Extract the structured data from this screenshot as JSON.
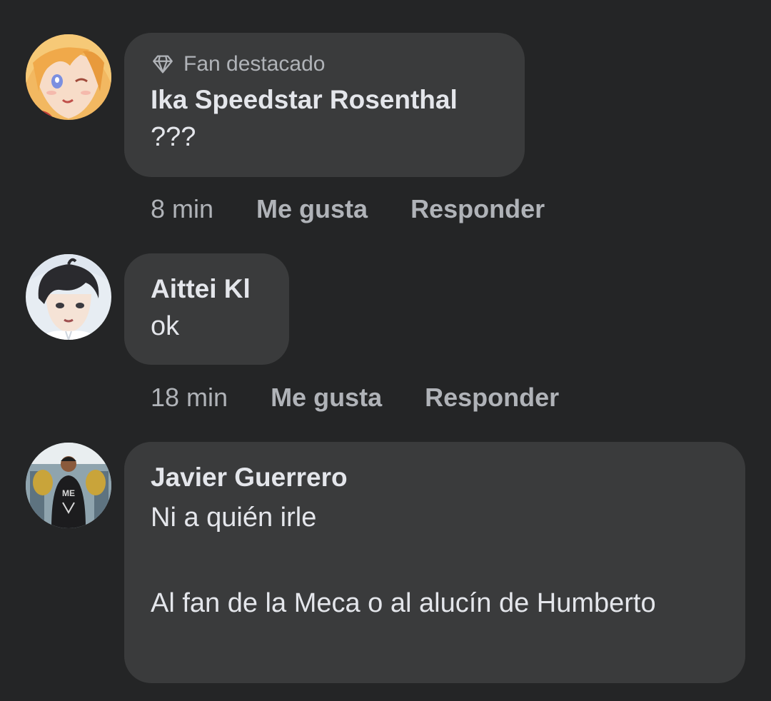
{
  "comments": [
    {
      "badge": "Fan destacado",
      "badge_icon": "diamond-icon",
      "author": "Ika Speedstar Rosenthal",
      "text": "???",
      "time": "8 min",
      "like_label": "Me gusta",
      "reply_label": "Responder"
    },
    {
      "author": "Aittei Kl",
      "text": "ok",
      "time": "18 min",
      "like_label": "Me gusta",
      "reply_label": "Responder"
    },
    {
      "author": "Javier Guerrero",
      "text": "Ni a quién irle\n\nAl fan de la Meca o al alucín de Humberto"
    }
  ],
  "colors": {
    "background": "#242526",
    "bubble": "#3a3b3c",
    "primary_text": "#e4e6eb",
    "secondary_text": "#b0b3b8"
  }
}
